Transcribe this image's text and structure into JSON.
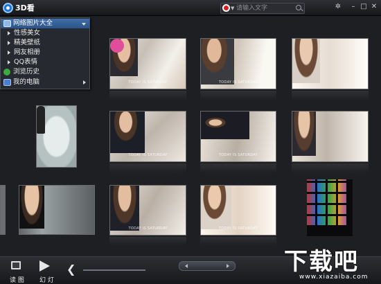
{
  "app": {
    "title": "3D看"
  },
  "search": {
    "placeholder": "请输入文字"
  },
  "menu": {
    "items": [
      {
        "label": "网络图片大全",
        "selected": true,
        "has_dropdown": true
      },
      {
        "label": "性感美女",
        "sub": true
      },
      {
        "label": "精美壁纸",
        "sub": true
      },
      {
        "label": "网友相册",
        "sub": true
      },
      {
        "label": "QQ表情",
        "sub": true
      },
      {
        "label": "浏览历史"
      },
      {
        "label": "我的电脑",
        "has_submenu": true
      }
    ]
  },
  "thumbnails": {
    "captions": [
      "TODAY IS SATURDAY",
      "TODAY IS SATURDAY",
      "TODAY IS SATURDAY",
      "TODAY IS SATURDAY",
      "TODAY IS SATURDAY",
      "TODAY IS SATURDAY"
    ]
  },
  "toolbar": {
    "read_label": "读 图",
    "slideshow_label": "幻 灯"
  },
  "watermark": {
    "brand": "下载吧",
    "url": "www.xiazaiba.com"
  },
  "colors": {
    "menu_selected": "#3f6ea9",
    "background": "#1e1f22"
  }
}
